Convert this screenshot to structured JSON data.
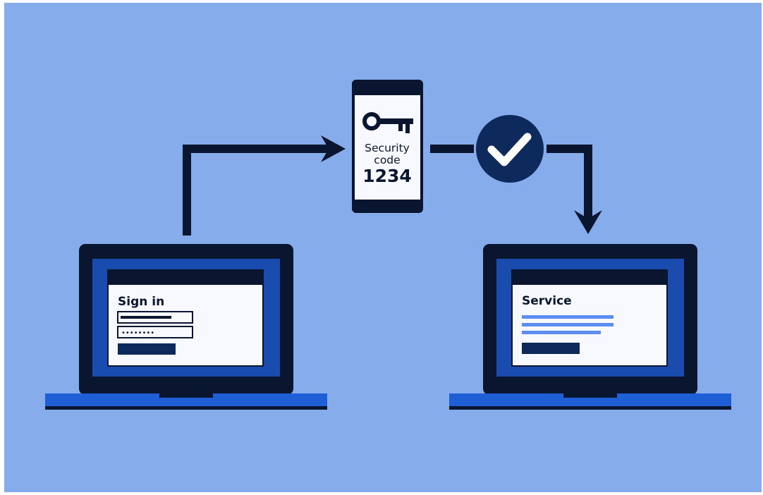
{
  "colors": {
    "background": "#87acec",
    "dark": "#0a1630",
    "navy": "#0e2a5c",
    "screen_blue": "#1a4cb0",
    "laptop_base": "#1f5fd6",
    "paper": "#f7f9ff",
    "line_blue": "#5b8ef0",
    "white": "#ffffff"
  },
  "icons": {
    "phone_key": "key-icon",
    "verify": "check-circle-icon",
    "password_dots": "password-dots"
  },
  "phone": {
    "label_line1": "Security",
    "label_line2": "code",
    "code": "1234"
  },
  "left_laptop": {
    "title": "Sign in",
    "password_mask": "••••••••"
  },
  "right_laptop": {
    "title": "Service"
  }
}
